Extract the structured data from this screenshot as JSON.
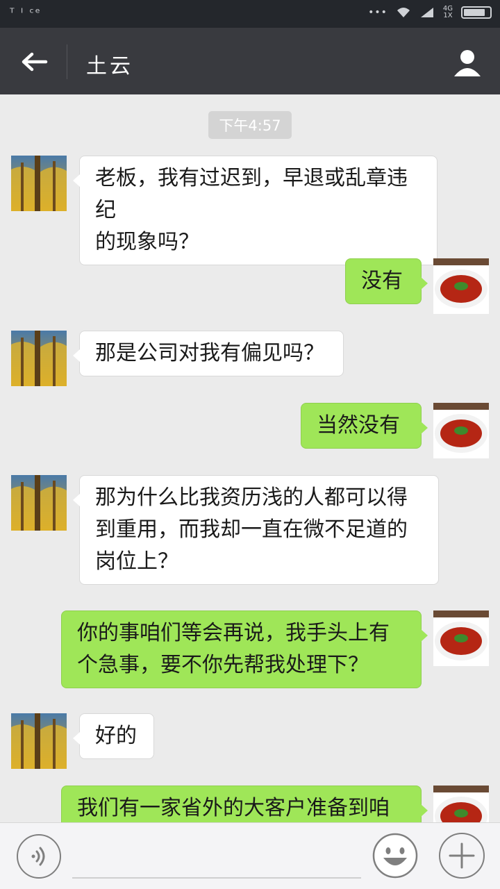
{
  "status_bar": {
    "carrier": "ᵀ ᴵ ᶜᵉ",
    "dots": "•••",
    "network_top": "4G",
    "network_bottom": "1X"
  },
  "header": {
    "back_icon": "back-arrow-icon",
    "title": "土云",
    "profile_icon": "person-icon"
  },
  "chat": {
    "timestamp": "下午4:57",
    "messages": [
      {
        "from": "contact",
        "text": "老板，我有过迟到，早退或乱章违纪\n的现象吗？"
      },
      {
        "from": "me",
        "text": "没有"
      },
      {
        "from": "contact",
        "text": "那是公司对我有偏见吗？"
      },
      {
        "from": "me",
        "text": "当然没有"
      },
      {
        "from": "contact",
        "text": "那为什么比我资历浅的人都可以得\n到重用，而我却一直在微不足道的\n岗位上？"
      },
      {
        "from": "me",
        "text": "你的事咱们等会再说，我手头上有\n个急事，要不你先帮我处理下？"
      },
      {
        "from": "contact",
        "text": "好的"
      },
      {
        "from": "me",
        "text": "我们有一家省外的大客户准备到咱"
      }
    ]
  },
  "input_bar": {
    "voice_icon": "voice-icon",
    "emoji_icon": "smiley-icon",
    "plus_icon": "plus-icon"
  },
  "colors": {
    "status_bg": "#24272c",
    "nav_bg": "#393a3f",
    "chat_bg": "#ebebeb",
    "outgoing": "#9fe658",
    "incoming": "#ffffff"
  }
}
